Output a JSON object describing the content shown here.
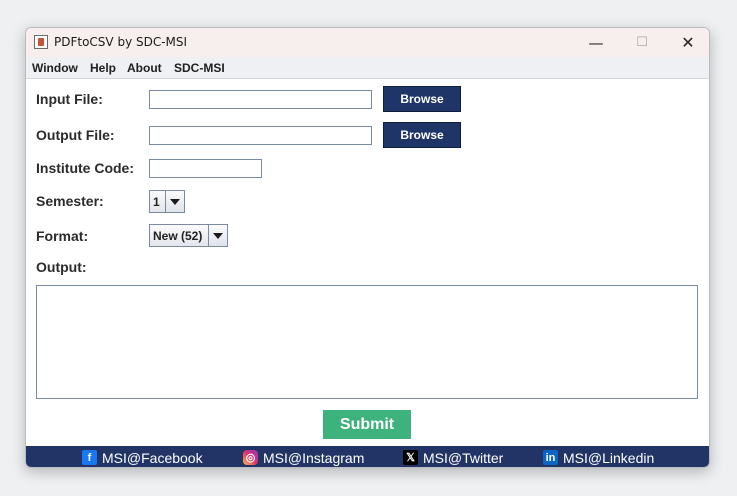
{
  "window": {
    "title": "PDFtoCSV by SDC-MSI",
    "minimize_glyph": "—",
    "maximize_glyph": "☐",
    "close_glyph": "✕"
  },
  "menu": [
    "Window",
    "Help",
    "About",
    "SDC-MSI"
  ],
  "form": {
    "input_file_label": "Input File:",
    "input_file_value": "",
    "output_file_label": "Output File:",
    "output_file_value": "",
    "browse_label": "Browse",
    "institute_code_label": "Institute Code:",
    "institute_code_value": "",
    "semester_label": "Semester:",
    "semester_value": "1",
    "format_label": "Format:",
    "format_value": "New (52)",
    "output_label": "Output:",
    "output_value": ""
  },
  "submit_label": "Submit",
  "footer": {
    "links": [
      {
        "icon": "facebook-icon",
        "glyph": "f",
        "label": "MSI@Facebook"
      },
      {
        "icon": "instagram-icon",
        "glyph": "◎",
        "label": "MSI@Instagram"
      },
      {
        "icon": "x-twitter-icon",
        "glyph": "𝕏",
        "label": "MSI@Twitter"
      },
      {
        "icon": "linkedin-icon",
        "glyph": "in",
        "label": "MSI@Linkedin"
      }
    ]
  },
  "colors": {
    "browse_button": "#1f3567",
    "submit_button": "#3db27c",
    "footer_bar": "#223466"
  }
}
